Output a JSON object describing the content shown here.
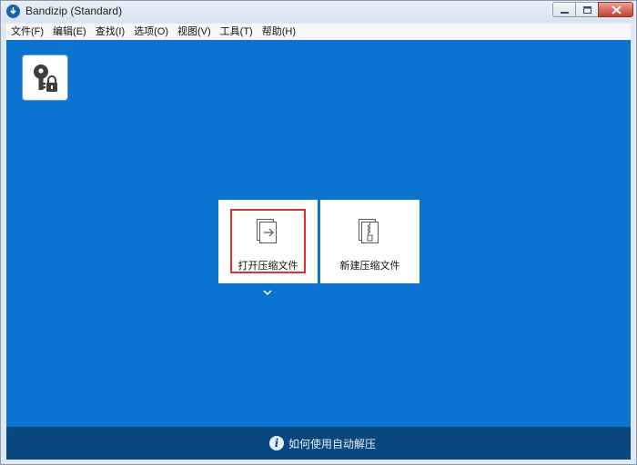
{
  "window": {
    "title": "Bandizip (Standard)"
  },
  "menu": [
    {
      "label": "文件(F)"
    },
    {
      "label": "编辑(E)"
    },
    {
      "label": "查找(I)"
    },
    {
      "label": "选项(O)"
    },
    {
      "label": "视图(V)"
    },
    {
      "label": "工具(T)"
    },
    {
      "label": "帮助(H)"
    }
  ],
  "actions": {
    "open_archive": "打开压缩文件",
    "new_archive": "新建压缩文件"
  },
  "footer": {
    "help_link": "如何使用自动解压"
  },
  "colors": {
    "main_bg": "#0a74d0",
    "footer_bg": "#0a477f",
    "highlight": "#e2312f"
  },
  "icons": {
    "app": "bandizip-app-icon",
    "password": "key-lock-icon",
    "open": "open-archive-icon",
    "new": "new-archive-icon",
    "expand": "chevron-down-icon",
    "info": "info-icon"
  }
}
